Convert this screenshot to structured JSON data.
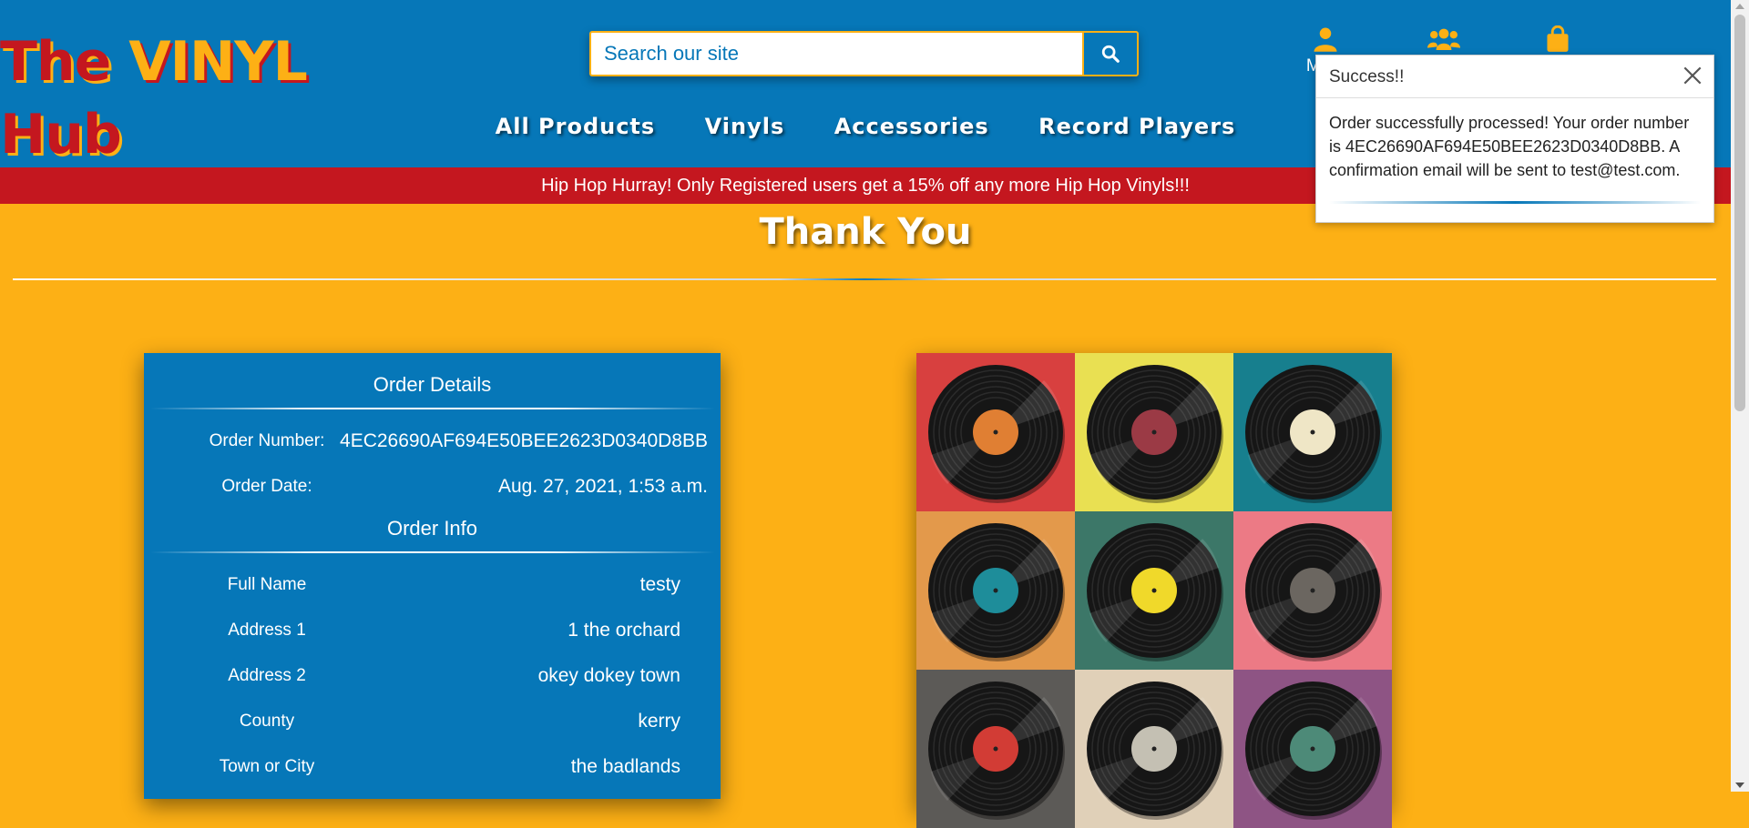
{
  "brand": {
    "logo_part1": "The ",
    "logo_part2": "VINYL",
    "logo_part3": " Hub"
  },
  "search": {
    "placeholder": "Search our site",
    "icon": "search-icon"
  },
  "header_icons": [
    {
      "label": "My A",
      "icon": "user-icon"
    },
    {
      "label": "",
      "icon": "users-icon"
    },
    {
      "label": "",
      "icon": "shopping-bag-icon"
    }
  ],
  "nav": [
    "All Products",
    "Vinyls",
    "Accessories",
    "Record Players"
  ],
  "banner": "Hip Hop Hurray! Only Registered users get a 15% off any more Hip Hop Vinyls!!!",
  "page_title": "Thank You",
  "order_details": {
    "heading": "Order Details",
    "rows": [
      {
        "label": "Order Number:",
        "value": "4EC26690AF694E50BEE2623D0340D8BB"
      },
      {
        "label": "Order Date:",
        "value": "Aug. 27, 2021, 1:53 a.m."
      }
    ]
  },
  "order_info": {
    "heading": "Order Info",
    "rows": [
      {
        "label": "Full Name",
        "value": "testy"
      },
      {
        "label": "Address 1",
        "value": "1 the orchard"
      },
      {
        "label": "Address 2",
        "value": "okey dokey town"
      },
      {
        "label": "County",
        "value": "kerry"
      },
      {
        "label": "Town or City",
        "value": "the badlands"
      }
    ]
  },
  "artwork": {
    "tiles": [
      {
        "bg": "#d8403f",
        "label": "#e07f33"
      },
      {
        "bg": "#e9e052",
        "label": "#9b3a45"
      },
      {
        "bg": "#177f8e",
        "label": "#efe6c6"
      },
      {
        "bg": "#e3994b",
        "label": "#1e8d9a"
      },
      {
        "bg": "#3c7768",
        "label": "#f0d92a"
      },
      {
        "bg": "#ec7a85",
        "label": "#6b6660"
      },
      {
        "bg": "#5c5a57",
        "label": "#d23c35"
      },
      {
        "bg": "#e0d0b8",
        "label": "#c4c0b3"
      },
      {
        "bg": "#8e5484",
        "label": "#4d8a78"
      }
    ]
  },
  "toast": {
    "title": "Success!!",
    "message": "Order successfully processed! Your order number is 4EC26690AF694E50BEE2623D0340D8BB. A confirmation email will be sent to test@test.com."
  },
  "colors": {
    "primary_blue": "#0677b8",
    "accent_yellow": "#fdb015",
    "accent_red": "#c4171f"
  }
}
